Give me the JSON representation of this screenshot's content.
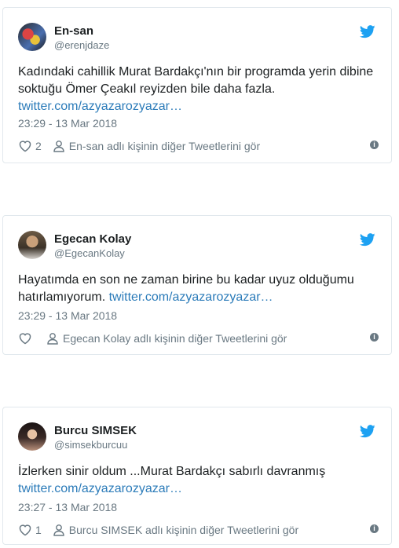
{
  "tweets": [
    {
      "name": "En-san",
      "handle": "@erenjdaze",
      "text": "Kadındaki cahillik Murat Bardakçı'nın bir programda yerin dibine soktuğu Ömer Çeakıl reyizden bile daha fazla.",
      "link": "twitter.com/azyazarozyazar…",
      "time": "23:29 - 13 Mar 2018",
      "likes": "2",
      "more_tweets": "En-san adlı kişinin diğer Tweetlerini gör"
    },
    {
      "name": "Egecan Kolay",
      "handle": "@EgecanKolay",
      "text": "Hayatımda en son ne zaman birine bu kadar uyuz olduğumu hatırlamıyorum.",
      "link": "twitter.com/azyazarozyazar…",
      "time": "23:29 - 13 Mar 2018",
      "likes": "",
      "more_tweets": "Egecan Kolay adlı kişinin diğer Tweetlerini gör"
    },
    {
      "name": "Burcu SIMSEK",
      "handle": "@simsekburcuu",
      "text": "İzlerken sinir oldum ...Murat Bardakçı sabırlı davranmış",
      "link": "twitter.com/azyazarozyazar…",
      "time": "23:27 - 13 Mar 2018",
      "likes": "1",
      "more_tweets": "Burcu SIMSEK adlı kişinin diğer Tweetlerini gör"
    }
  ],
  "icons": {
    "bird": "twitter-bird-icon",
    "heart": "heart-icon",
    "person": "person-icon",
    "info": "info-icon"
  },
  "colors": {
    "brand": "#1da1f2",
    "link": "#2b7bb9",
    "muted": "#697882",
    "border": "#e1e8ed"
  }
}
